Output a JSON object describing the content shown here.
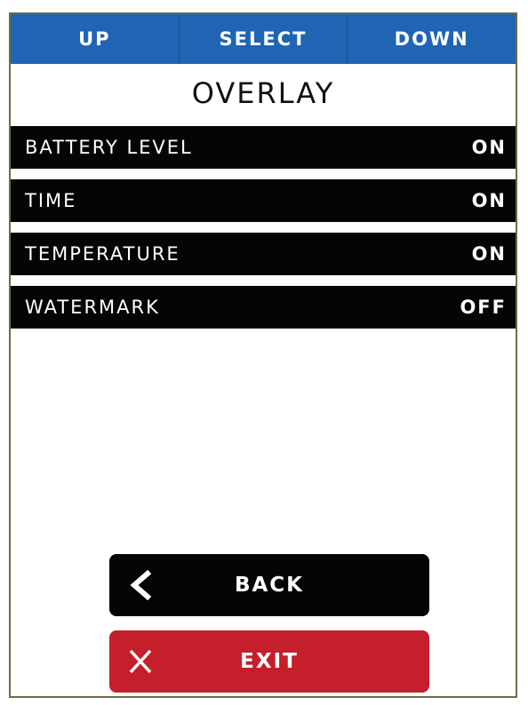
{
  "nav": {
    "up_label": "UP",
    "select_label": "SELECT",
    "down_label": "DOWN"
  },
  "screen": {
    "title": "OVERLAY"
  },
  "settings": [
    {
      "label": "BATTERY LEVEL",
      "value": "ON"
    },
    {
      "label": "TIME",
      "value": "ON"
    },
    {
      "label": "TEMPERATURE",
      "value": "ON"
    },
    {
      "label": "WATERMARK",
      "value": "OFF"
    }
  ],
  "actions": {
    "back_label": "BACK",
    "back_icon": "chevron-left-icon",
    "exit_label": "EXIT",
    "exit_icon": "close-icon"
  },
  "colors": {
    "topbar": "#1f65b3",
    "row": "#050505",
    "exit": "#c41f2b"
  }
}
